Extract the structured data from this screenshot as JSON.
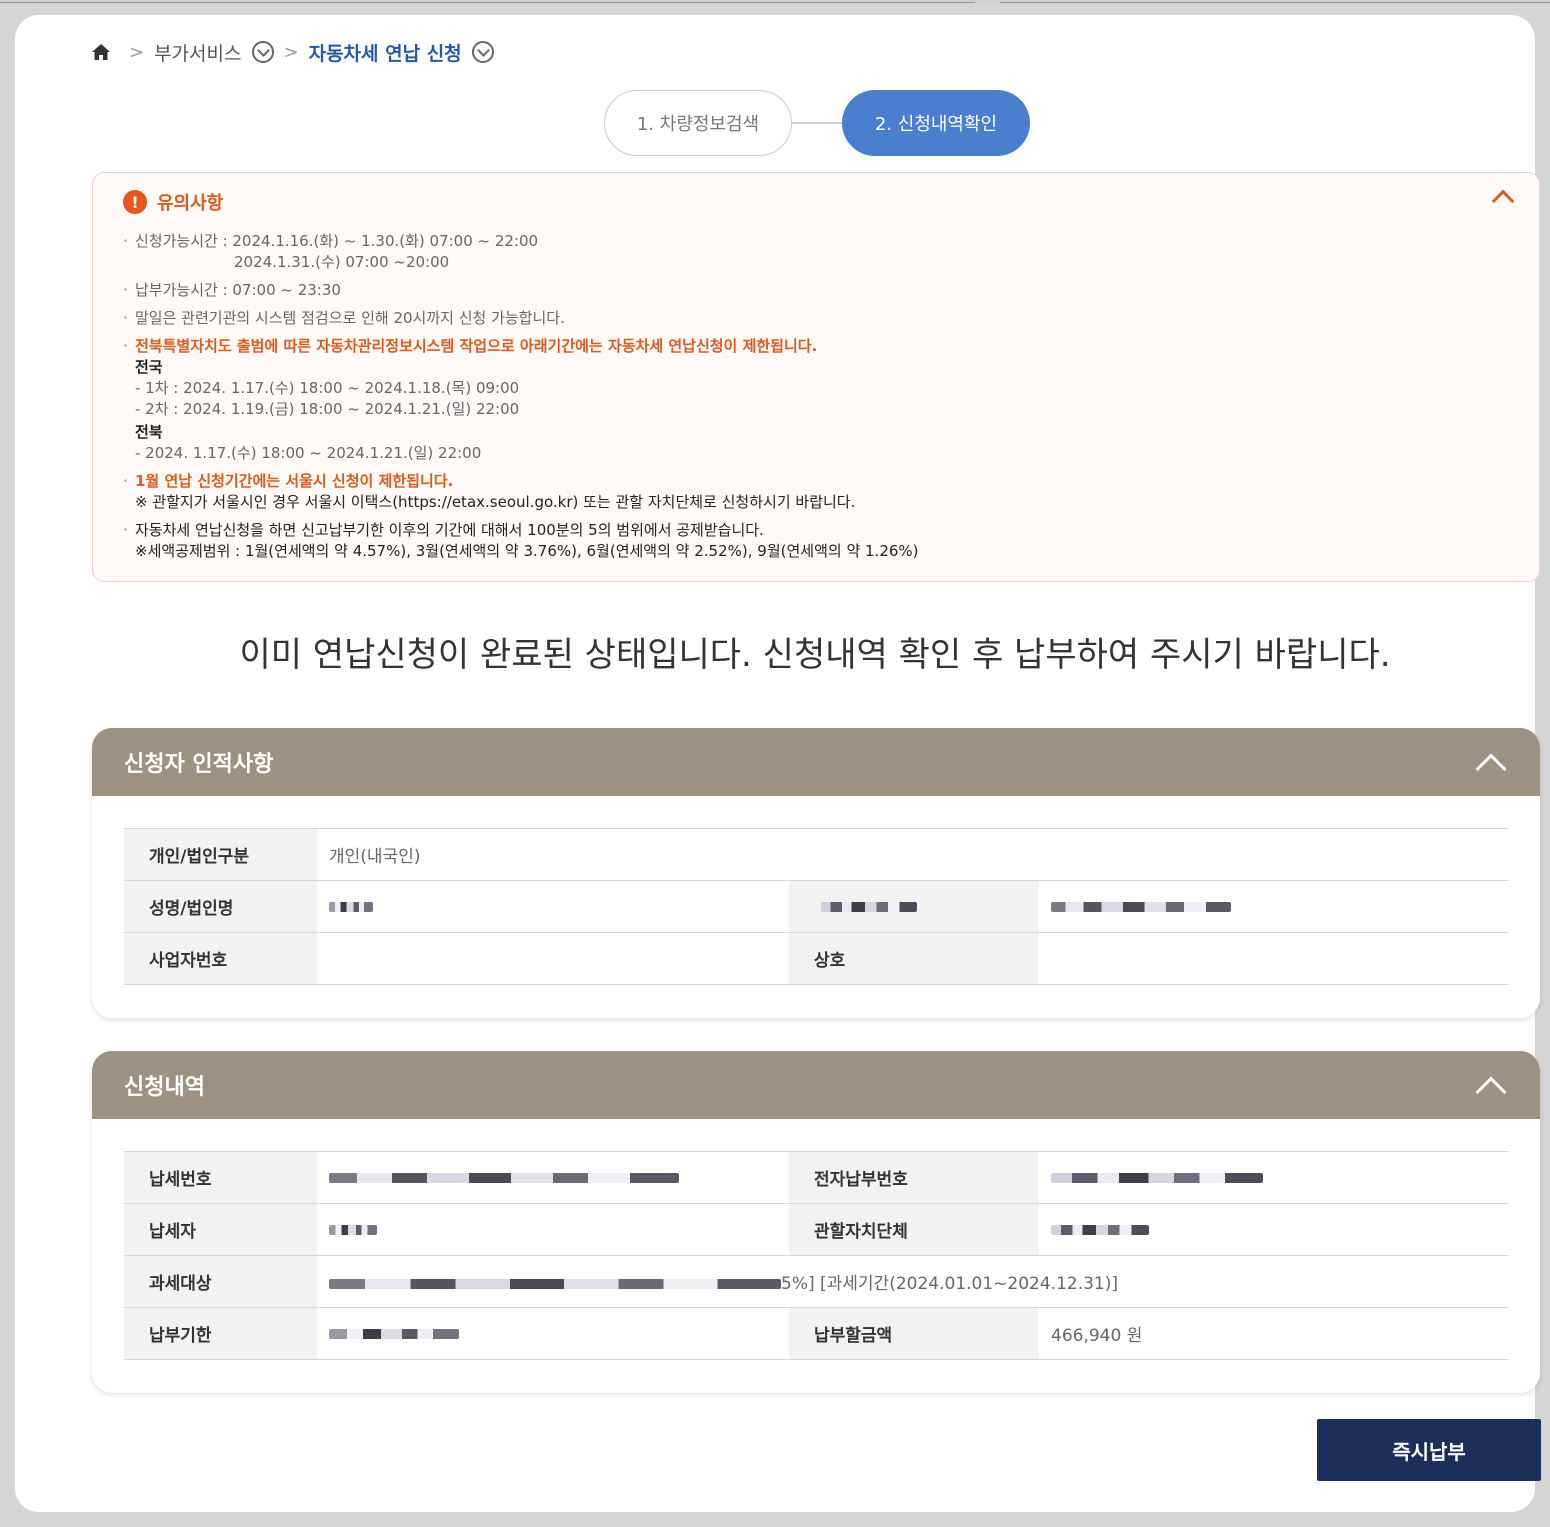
{
  "breadcrumb": {
    "parent": "부가서비스",
    "current": "자동차세 연납 신청"
  },
  "steps": [
    {
      "label": "1. 차량정보검색",
      "active": false
    },
    {
      "label": "2. 신청내역확인",
      "active": true
    }
  ],
  "notice": {
    "title": "유의사항",
    "lines": {
      "apply_time_1": "신청가능시간 : 2024.1.16.(화) ~ 1.30.(화) 07:00 ~ 22:00",
      "apply_time_2": "2024.1.31.(수) 07:00 ~20:00",
      "pay_time": "납부가능시간 : 07:00 ~ 23:30",
      "month_end": "말일은 관련기관의 시스템 점검으로 인해 20시까지 신청 가능합니다.",
      "restriction": "전북특별자치도 출범에 따른 자동차관리정보시스템 작업으로 아래기간에는 자동차세 연납신청이 제한됩니다.",
      "nationwide": "전국",
      "round1": "- 1차 : 2024. 1.17.(수) 18:00 ~ 2024.1.18.(목) 09:00",
      "round2": "- 2차 : 2024. 1.19.(금) 18:00 ~ 2024.1.21.(일) 22:00",
      "jeonbuk": "전북",
      "jeonbuk_period": "- 2024. 1.17.(수) 18:00 ~ 2024.1.21.(일) 22:00",
      "seoul_restrict": "1월 연납 신청기간에는 서울시 신청이 제한됩니다.",
      "seoul_note": "※ 관할지가 서울시인 경우 서울시 이택스(https://etax.seoul.go.kr) 또는 관할 자치단체로 신청하시기 바랍니다.",
      "deduction": "자동차세 연납신청을 하면 신고납부기한 이후의 기간에 대해서 100분의 5의 범위에서 공제받습니다.",
      "deduction_range": "※세액공제범위 : 1월(연세액의 약 4.57%), 3월(연세액의 약 3.76%), 6월(연세액의 약 2.52%), 9월(연세액의 약 1.26%)"
    }
  },
  "headline": "이미 연납신청이 완료된 상태입니다. 신청내역 확인 후 납부하여 주시기 바랍니다.",
  "applicant": {
    "title": "신청자 인적사항",
    "type_label": "개인/법인구분",
    "type_value": "개인(내국인)",
    "name_label": "성명/법인명",
    "bizno_label": "사업자번호",
    "company_label": "상호"
  },
  "details": {
    "title": "신청내역",
    "taxno_label": "납세번호",
    "epayno_label": "전자납부번호",
    "taxpayer_label": "납세자",
    "authority_label": "관할자치단체",
    "subject_label": "과세대상",
    "subject_value_tail": "5%] [과세기간(2024.01.01~2024.12.31)]",
    "due_label": "납부기한",
    "amount_label": "납부할금액",
    "amount_value": "466,940 원"
  },
  "pay_button": "즉시납부",
  "colors": {
    "accent_blue": "#4a7fcf",
    "breadcrumb_blue": "#2459a8",
    "warning_orange": "#e05a1a",
    "section_header": "#9b9282",
    "button_navy": "#1c2f5c"
  }
}
